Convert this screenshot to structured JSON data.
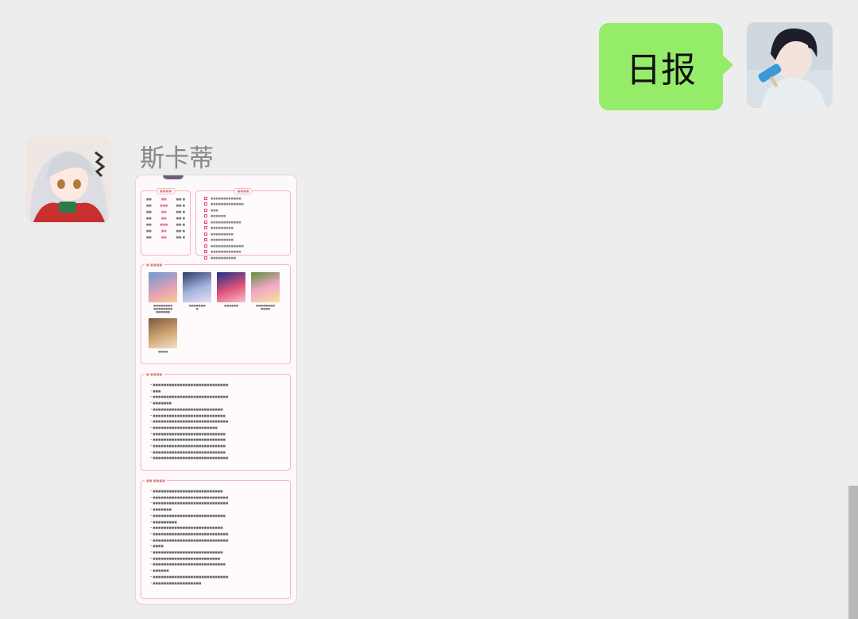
{
  "chat": {
    "my_message": "日报",
    "sender_name": "斯卡蒂"
  },
  "icons": {
    "my_avatar": "avatar-boy-icon",
    "other_avatar": "avatar-girl-icon"
  },
  "colors": {
    "background": "#ededed",
    "my_bubble": "#95ec69",
    "card_border": "#f3b5c4"
  }
}
